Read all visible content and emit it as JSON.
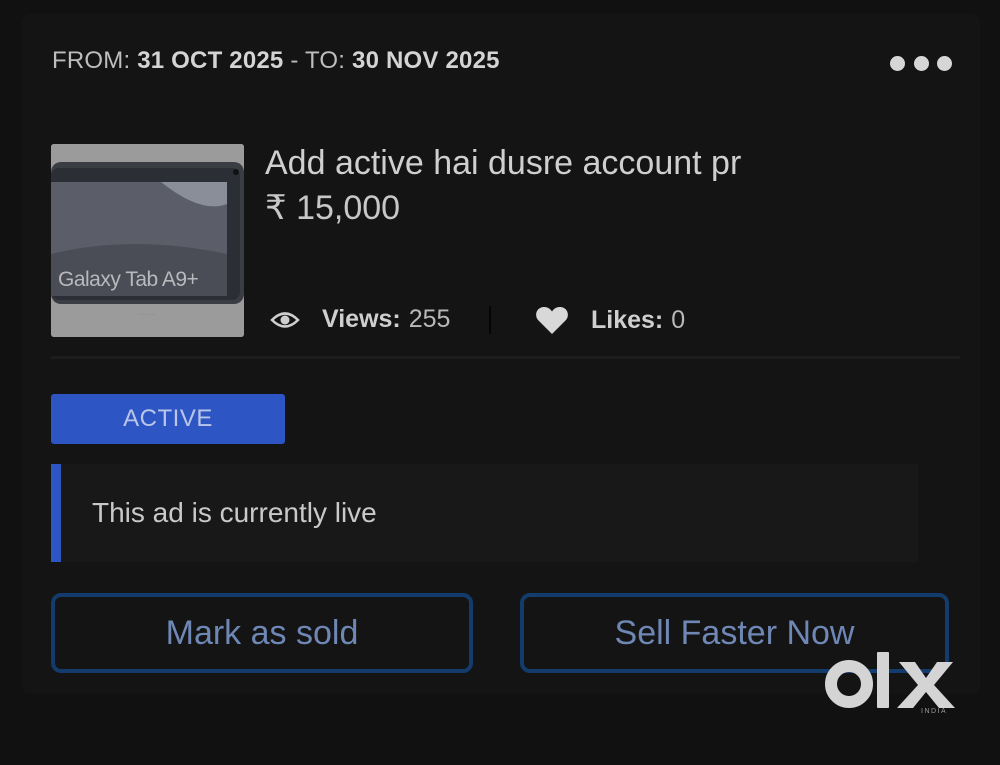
{
  "listing": {
    "date_from_label": "FROM: ",
    "date_from": "31 OCT 2025",
    "date_sep": " - TO: ",
    "date_to": "30 NOV 2025",
    "title": "Add active hai dusre account pr",
    "price": "₹ 15,000",
    "thumbnail_text": "Galaxy Tab A9+",
    "views_label": "Views:",
    "views_count": "255",
    "likes_label": "Likes:",
    "likes_count": "0",
    "status": "ACTIVE",
    "status_message": "This ad is currently live"
  },
  "actions": {
    "mark_sold": "Mark as sold",
    "sell_faster": "Sell Faster Now"
  },
  "icons": {
    "more": "more-dots-icon",
    "views": "eye-icon",
    "likes": "heart-icon"
  },
  "watermark": {
    "brand": "OLX",
    "region": "INDIA"
  },
  "colors": {
    "background": "#111111",
    "accent_blue": "#2d55c3",
    "button_border": "#133b6b",
    "button_text": "#6e87b5"
  }
}
